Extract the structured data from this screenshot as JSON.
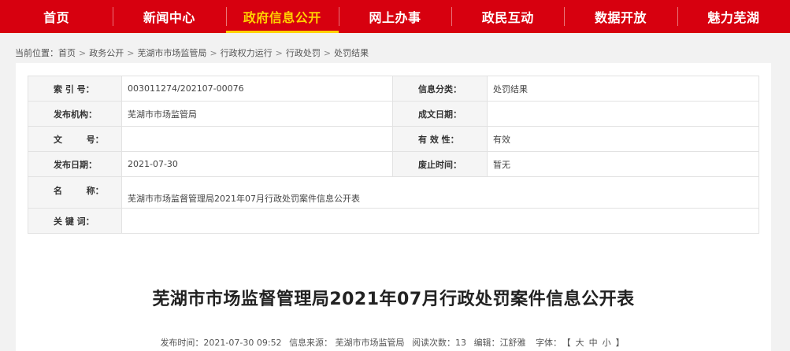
{
  "nav": {
    "items": [
      {
        "label": "首页"
      },
      {
        "label": "新闻中心"
      },
      {
        "label": "政府信息公开"
      },
      {
        "label": "网上办事"
      },
      {
        "label": "政民互动"
      },
      {
        "label": "数据开放"
      },
      {
        "label": "魅力芜湖"
      }
    ],
    "active_color": "#ffd200",
    "background": "#d7000f"
  },
  "breadcrumb": {
    "prefix": "当前位置：",
    "items": [
      "首页",
      "政务公开",
      "芜湖市市场监管局",
      "行政权力运行",
      "行政处罚",
      "处罚结果"
    ],
    "separator": ">"
  },
  "meta": {
    "index_label": "索 引 号：",
    "index_value": "003011274/202107-00076",
    "category_label": "信息分类：",
    "category_value": "处罚结果",
    "publisher_label": "发布机构：",
    "publisher_value": "芜湖市市场监管局",
    "created_label": "成文日期：",
    "created_value": "",
    "docno_label": "文        号：",
    "docno_value": "",
    "validity_label": "有 效 性：",
    "validity_value": "有效",
    "pubdate_label": "发布日期：",
    "pubdate_value": "2021-07-30",
    "expiry_label": "废止时间：",
    "expiry_value": "暂无",
    "name_label": "名        称：",
    "name_value": "芜湖市市场监督管理局2021年07月行政处罚案件信息公开表",
    "keywords_label": "关 键 词：",
    "keywords_value": ""
  },
  "article": {
    "title": "芜湖市市场监督管理局2021年07月行政处罚案件信息公开表",
    "publish_time": "发布时间：2021-07-30 09:52",
    "source": "信息来源： 芜湖市市场监管局",
    "views": "阅读次数：13",
    "editor": "编辑：江舒雅",
    "font_label": "字体：",
    "font_open": "【",
    "font_large": "大",
    "font_medium": "中",
    "font_small": "小",
    "font_close": "】"
  }
}
